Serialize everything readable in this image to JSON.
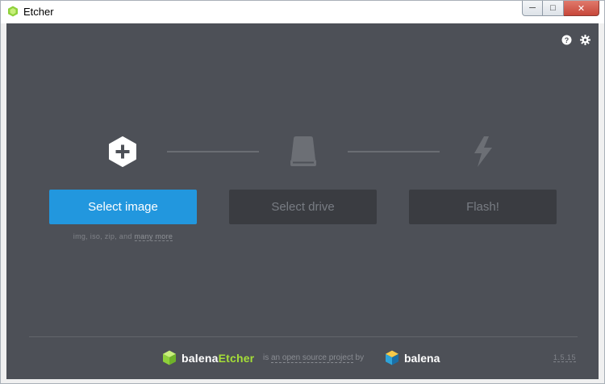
{
  "window": {
    "title": "Etcher",
    "min_label": "─",
    "max_label": "□",
    "close_label": "✕"
  },
  "colors": {
    "background": "#4d5057",
    "primary": "#2297de",
    "disabled_bg": "#3a3c41",
    "accent_green": "#a5de37"
  },
  "top_icons": [
    "help-icon",
    "settings-icon"
  ],
  "steps": {
    "image": {
      "icon": "plus-hexagon-icon",
      "button_label": "Select image"
    },
    "drive": {
      "icon": "drive-icon",
      "button_label": "Select drive"
    },
    "flash": {
      "icon": "lightning-icon",
      "button_label": "Flash!"
    }
  },
  "formats": {
    "prefix": "img, iso, zip, and ",
    "more_link": "many more"
  },
  "footer": {
    "brand_prefix": "balena",
    "brand_suffix": "Etcher",
    "middle_prefix": "is ",
    "middle_link": "an open source project",
    "middle_suffix": " by",
    "company": "balena",
    "version": "1.5.15"
  }
}
